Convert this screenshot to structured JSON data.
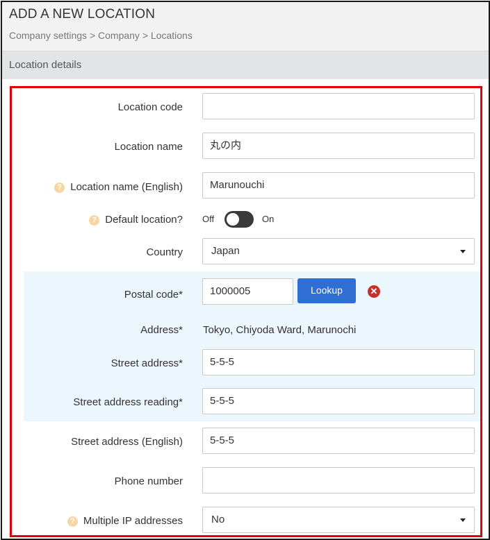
{
  "header": {
    "title": "ADD A NEW LOCATION",
    "breadcrumb": "Company settings > Company > Locations"
  },
  "section": {
    "title": "Location details"
  },
  "form": {
    "location_code": {
      "label": "Location code",
      "value": ""
    },
    "location_name": {
      "label": "Location name",
      "value": "丸の内"
    },
    "location_name_en": {
      "label": "Location name (English)",
      "value": "Marunouchi",
      "help_icon": "?"
    },
    "default_location": {
      "label": "Default location?",
      "off_label": "Off",
      "on_label": "On",
      "state": "off",
      "help_icon": "?"
    },
    "country": {
      "label": "Country",
      "value": "Japan"
    },
    "postal_code": {
      "label": "Postal code*",
      "value": "1000005",
      "lookup_label": "Lookup",
      "clear_icon": "✕"
    },
    "address": {
      "label": "Address*",
      "value": "Tokyo, Chiyoda Ward, Marunochi"
    },
    "street_address": {
      "label": "Street address*",
      "value": "5-5-5"
    },
    "street_address_reading": {
      "label": "Street address reading*",
      "value": "5-5-5"
    },
    "street_address_en": {
      "label": "Street address (English)",
      "value": "5-5-5"
    },
    "phone_number": {
      "label": "Phone number",
      "value": ""
    },
    "multiple_ip": {
      "label": "Multiple IP addresses",
      "value": "No",
      "help_icon": "?"
    }
  },
  "colors": {
    "highlight_border": "#e0000a",
    "lookup_button": "#2f6fd4",
    "clear_icon": "#c9302c",
    "highlight_band": "#ecf6fd",
    "help_icon": "#f6d7a4"
  }
}
